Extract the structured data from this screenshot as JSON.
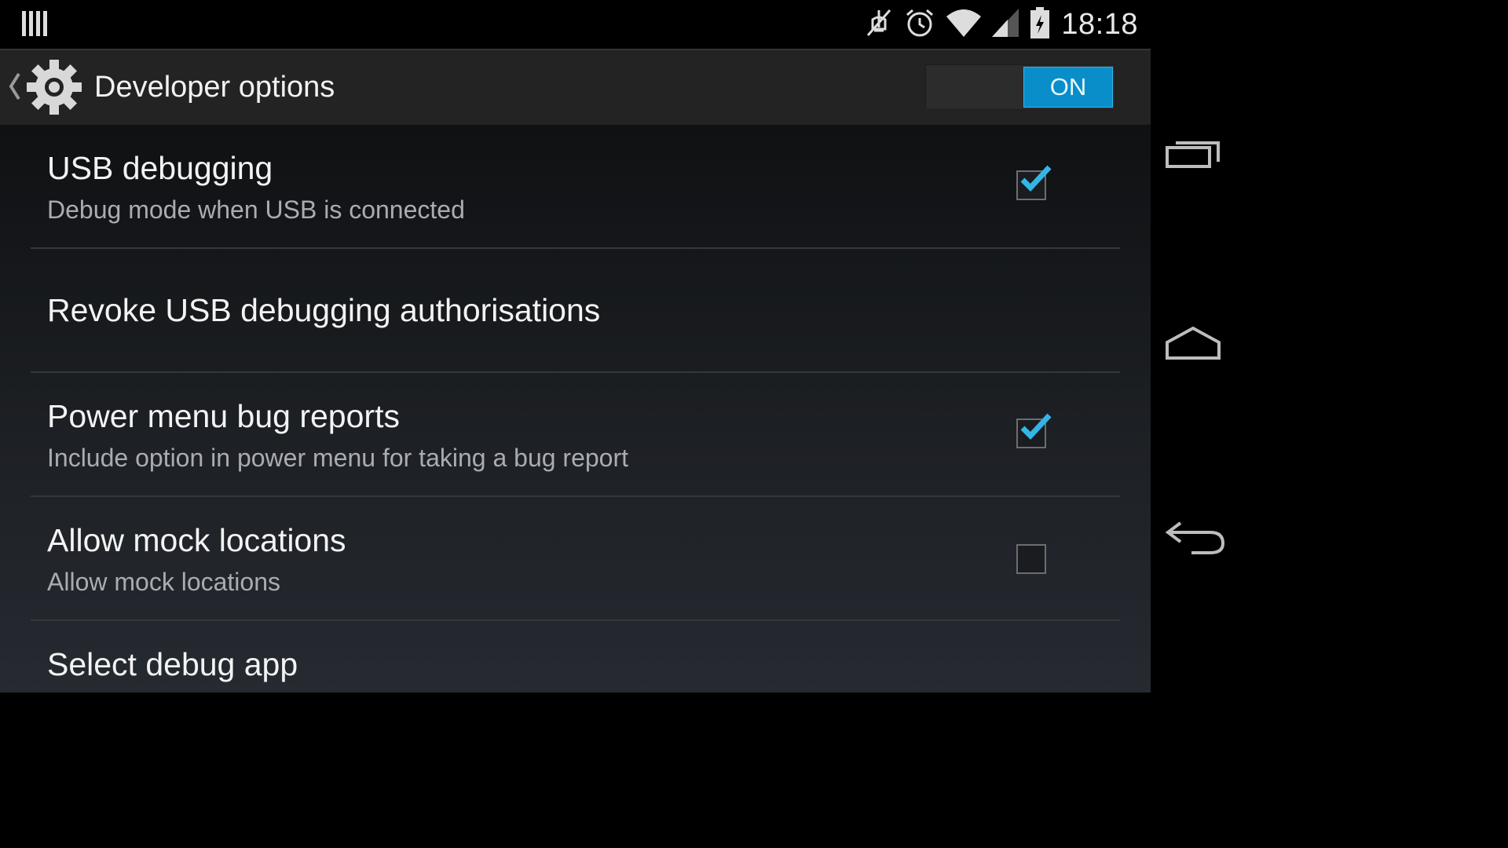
{
  "status_bar": {
    "time": "18:18",
    "icons": [
      "notification-bars-icon",
      "mute-icon",
      "alarm-icon",
      "wifi-icon",
      "signal-icon",
      "battery-charging-icon"
    ]
  },
  "action_bar": {
    "title": "Developer options",
    "switch_label": "ON",
    "switch_on": true
  },
  "settings": [
    {
      "title": "USB debugging",
      "summary": "Debug mode when USB is connected",
      "checked": true
    },
    {
      "title": "Revoke USB debugging authorisations",
      "summary": ""
    },
    {
      "title": "Power menu bug reports",
      "summary": "Include option in power menu for taking a bug report",
      "checked": true
    },
    {
      "title": "Allow mock locations",
      "summary": "Allow mock locations",
      "checked": false
    },
    {
      "title": "Select debug app",
      "summary": ""
    }
  ],
  "colors": {
    "accent": "#33b5e5",
    "switch_on": "#0a8ec9",
    "background": "#1d2024"
  },
  "nav_bar": {
    "buttons": [
      "recent-apps-icon",
      "home-icon",
      "back-icon"
    ]
  }
}
